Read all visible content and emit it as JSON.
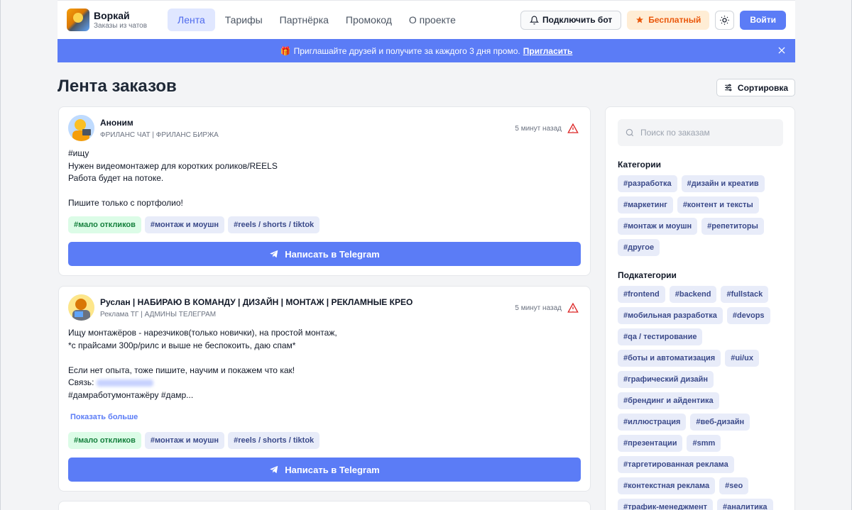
{
  "header": {
    "app_name": "Воркай",
    "app_subtitle": "Заказы из чатов",
    "nav": [
      {
        "label": "Лента",
        "active": true
      },
      {
        "label": "Тарифы"
      },
      {
        "label": "Партнёрка"
      },
      {
        "label": "Промокод"
      },
      {
        "label": "О проекте"
      }
    ],
    "bot_button": "Подключить бот",
    "free_button": "Бесплатный",
    "login_button": "Войти"
  },
  "banner": {
    "icon": "🎁",
    "text": "Приглашайте друзей и получите за каждого 3 дня промо.",
    "link": "Пригласить"
  },
  "page": {
    "title": "Лента заказов",
    "sort_button": "Сортировка"
  },
  "orders": [
    {
      "author": "Аноним",
      "source": "ФРИЛАНС ЧАТ | ФРИЛАНС БИРЖА",
      "time": "5 минут назад",
      "lines": [
        "#ищу",
        "Нужен видеомонтажер для коротких роликов/REELS",
        "Работа будет на потоке.",
        "",
        "Пишите только с портфолио!"
      ],
      "tags": [
        "#мало откликов",
        "#монтаж и моушн",
        "#reels / shorts / tiktok"
      ],
      "button": "Написать в Telegram"
    },
    {
      "author": "Руслан | НАБИРАЮ В КОМАНДУ | ДИЗАЙН | МОНТАЖ | РЕКЛАМНЫЕ КРЕО",
      "source": "Реклама ТГ | АДМИНЫ ТЕЛЕГРАМ",
      "time": "5 минут назад",
      "lines": [
        "Ищу монтажёров - нарезчиков(только новички), на простой монтаж,",
        "*с прайсами 300р/рилс и выше не беспокоить, даю спам*",
        "",
        "Если нет опыта, тоже пишите, научим и покажем что как!",
        "Связь:",
        "#дамработумонтажёру #дамр..."
      ],
      "show_more": "Показать больше",
      "tags": [
        "#мало откликов",
        "#монтаж и моушн",
        "#reels / shorts / tiktok"
      ],
      "button": "Написать в Telegram"
    }
  ],
  "sidebar": {
    "search_placeholder": "Поиск по заказам",
    "categories_title": "Категории",
    "categories": [
      "#разработка",
      "#дизайн и креатив",
      "#маркетинг",
      "#контент и тексты",
      "#монтаж и моушн",
      "#репетиторы",
      "#другое"
    ],
    "subcategories_title": "Подкатегории",
    "subcategories": [
      "#frontend",
      "#backend",
      "#fullstack",
      "#мобильная разработка",
      "#devops",
      "#qa / тестирование",
      "#боты и автоматизация",
      "#ui/ux",
      "#графический дизайн",
      "#брендинг и айдентика",
      "#иллюстрация",
      "#веб-дизайн",
      "#презентации",
      "#smm",
      "#таргетированная реклама",
      "#контекстная реклама",
      "#seo",
      "#трафик-менеджмент",
      "#аналитика"
    ]
  },
  "colors": {
    "accent": "#5b7cf6",
    "background": "#f3f4f6",
    "green_tag": "#dcfce7",
    "warning": "#dc2626"
  }
}
